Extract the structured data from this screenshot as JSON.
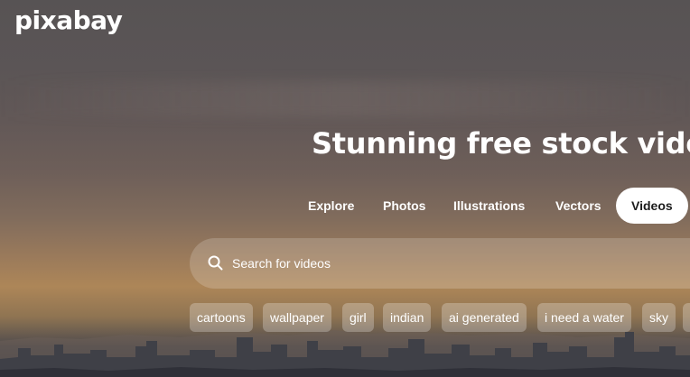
{
  "brand": {
    "logo_text": "pixabay"
  },
  "hero": {
    "headline": "Stunning free stock video f"
  },
  "tabs": [
    {
      "label": "Explore",
      "active": false
    },
    {
      "label": "Photos",
      "active": false
    },
    {
      "label": "Illustrations",
      "active": false
    },
    {
      "label": "Vectors",
      "active": false
    },
    {
      "label": "Videos",
      "active": true
    }
  ],
  "search": {
    "placeholder": "Search for videos",
    "icon": "search-icon"
  },
  "suggestions": [
    "cartoons",
    "wallpaper",
    "girl",
    "indian",
    "ai generated",
    "i need a water",
    "sky"
  ],
  "colors": {
    "text": "#ffffff",
    "active_tab_bg": "#ffffff",
    "active_tab_text": "#1c1c1c"
  }
}
